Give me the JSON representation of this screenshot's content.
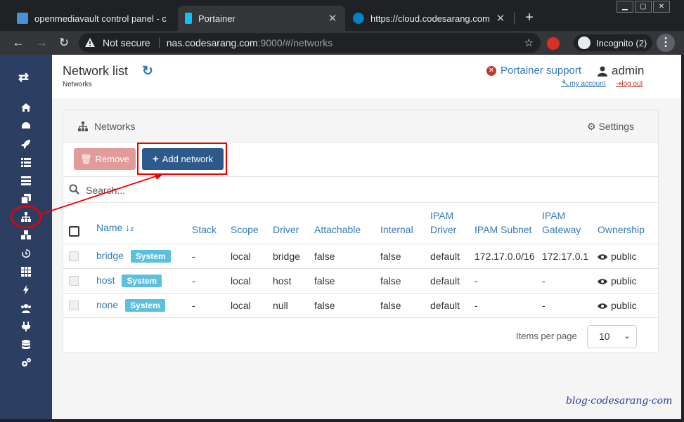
{
  "browser": {
    "tabs": [
      {
        "title": "openmediavault control panel - c",
        "active": false
      },
      {
        "title": "Portainer",
        "active": true
      },
      {
        "title": "https://cloud.codesarang.com",
        "active": false
      }
    ],
    "new_tab_label": "+",
    "address": {
      "security_label": "Not secure",
      "host": "nas.codesarang.com",
      "path": ":9000/#/networks"
    },
    "incognito_label": "Incognito (2)"
  },
  "sidebar": {
    "items": [
      "home-icon",
      "dashboard-icon",
      "rocket-icon",
      "th-list-icon",
      "server-icon",
      "clone-icon",
      "sitemap-icon",
      "cubes-icon",
      "history-icon",
      "th-icon",
      "bolt-icon",
      "users-icon",
      "plug-icon",
      "database-icon",
      "cogs-icon"
    ],
    "active": "sitemap-icon"
  },
  "header": {
    "title": "Network list",
    "breadcrumb": "Networks",
    "support_label": "Portainer support",
    "user": "admin",
    "my_account": "my account",
    "log_out": "log out"
  },
  "widget": {
    "title": "Networks",
    "settings_label": "Settings",
    "remove_label": "Remove",
    "add_label": "Add network",
    "search_placeholder": "Search...",
    "columns": [
      "Name",
      "Stack",
      "Scope",
      "Driver",
      "Attachable",
      "Internal",
      "IPAM Driver",
      "IPAM Subnet",
      "IPAM Gateway",
      "Ownership"
    ],
    "rows": [
      {
        "name": "bridge",
        "badge": "System",
        "stack": "-",
        "scope": "local",
        "driver": "bridge",
        "attachable": "false",
        "internal": "false",
        "ipam_driver": "default",
        "ipam_subnet": "172.17.0.0/16",
        "ipam_gateway": "172.17.0.1",
        "ownership": "public"
      },
      {
        "name": "host",
        "badge": "System",
        "stack": "-",
        "scope": "local",
        "driver": "host",
        "attachable": "false",
        "internal": "false",
        "ipam_driver": "default",
        "ipam_subnet": "-",
        "ipam_gateway": "-",
        "ownership": "public"
      },
      {
        "name": "none",
        "badge": "System",
        "stack": "-",
        "scope": "local",
        "driver": "null",
        "attachable": "false",
        "internal": "false",
        "ipam_driver": "default",
        "ipam_subnet": "-",
        "ipam_gateway": "-",
        "ownership": "public"
      }
    ],
    "items_per_page_label": "Items per page",
    "items_per_page": "10"
  },
  "watermark": "blog·codesarang·com",
  "colors": {
    "sidebar": "#2d3e63",
    "link": "#337ab7",
    "primary": "#2d5a8a",
    "danger": "#e19b98",
    "badge": "#5bc0de",
    "annotation": "#e00000"
  }
}
